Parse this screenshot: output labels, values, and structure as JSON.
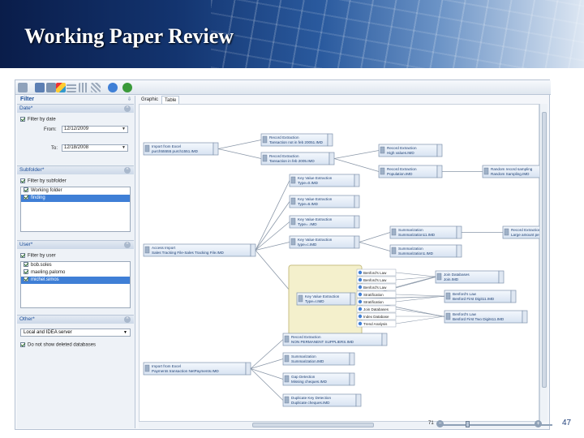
{
  "slide": {
    "title": "Working Paper Review",
    "page_number": "47"
  },
  "filter": {
    "title": "Filter",
    "pin": "⇩",
    "date_section": {
      "title": "Date*",
      "collapse": "^",
      "checkbox_label": "Filter by date",
      "from_label": "From:",
      "from_value": "12/12/2009",
      "to_label": "To:",
      "to_value": "12/18/2008"
    },
    "subfolder_section": {
      "title": "Subfolder*",
      "collapse": "^",
      "checkbox_label": "Filter by subfolder",
      "items": [
        {
          "label": "Working folder",
          "checked": true,
          "selected": false
        },
        {
          "label": "finding",
          "checked": true,
          "selected": true
        }
      ]
    },
    "user_section": {
      "title": "User*",
      "collapse": "^",
      "checkbox_label": "Filter by user",
      "items": [
        {
          "label": "bob.soles",
          "checked": true,
          "selected": false
        },
        {
          "label": "maeling.palomo",
          "checked": true,
          "selected": false
        },
        {
          "label": "michel.simos",
          "checked": true,
          "selected": true
        }
      ]
    },
    "other_section": {
      "title": "Other*",
      "collapse": "^",
      "server_value": "Local and IDEA server",
      "checkbox_label": "Do not show deleted databases"
    }
  },
  "tabs": [
    {
      "label": "Graphic",
      "active": false
    },
    {
      "label": "Table",
      "active": true
    }
  ],
  "zoom": {
    "value": "71",
    "minus": "−",
    "plus": "+"
  },
  "graph": {
    "nodes": [
      {
        "id": "n1",
        "line1": "Import from Excel",
        "line2": "purch55555 purch1551.IMD"
      },
      {
        "id": "n2",
        "line1": "Record Extraction",
        "line2": "Tansaction not in feb 20051.IMD"
      },
      {
        "id": "n3",
        "line1": "Record Extraction",
        "line2": "Tansaction in feb 2005.IMD"
      },
      {
        "id": "n4",
        "line1": "Record Extraction",
        "line2": "High values.IMD"
      },
      {
        "id": "n5",
        "line1": "Record Extraction",
        "line2": "Population.IMD"
      },
      {
        "id": "n6",
        "line1": "Random record sampling",
        "line2": "Random Sampling.IMD"
      },
      {
        "id": "n7",
        "line1": "Key Value Extraction",
        "line2": "Type=0.IMD"
      },
      {
        "id": "n8",
        "line1": "Key Value Extraction",
        "line2": "Type=6.IMD"
      },
      {
        "id": "n9",
        "line1": "Key Value Extraction",
        "line2": "Type= .IMD"
      },
      {
        "id": "n10",
        "line1": "Key Value Extraction",
        "line2": "type=c.IMD"
      },
      {
        "id": "n11",
        "line1": "Access Import",
        "line2": "Sales Tracking File-Sales Tracking File.IMD"
      },
      {
        "id": "n12",
        "line1": "Summarization",
        "line2": "Summarization11.IMD"
      },
      {
        "id": "n13",
        "line1": "Summarization",
        "line2": "Summarization1.IMD"
      },
      {
        "id": "n14",
        "line1": "Record Extraction",
        "line2": "Large amount pe"
      },
      {
        "id": "n15",
        "line1": "Key Value Extraction",
        "line2": "Type=r.IMD"
      },
      {
        "id": "n16",
        "line1": "Join Databases",
        "line2": "Join.IMD"
      },
      {
        "id": "n17",
        "line1": "Benford's Law",
        "line2": "Benford First Digit11.IMD"
      },
      {
        "id": "n18",
        "line1": "Benford's Law",
        "line2": "Benford First Two Digits11.IMD"
      },
      {
        "id": "n19",
        "line1": "Record Extraction",
        "line2": "NON PERMANENT SUPPLIERS.IMD"
      },
      {
        "id": "n20",
        "line1": "Import from Excel",
        "line2": "Payments transaction NetPayments.IMD"
      },
      {
        "id": "n21",
        "line1": "Summarization",
        "line2": "Summarization.IMD"
      },
      {
        "id": "n22",
        "line1": "Gap Detection",
        "line2": "Missing cheques.IMD"
      },
      {
        "id": "n23",
        "line1": "Duplicate Key Detection",
        "line2": "Duplicate cheques.IMD"
      }
    ],
    "menu_items": [
      "Benford's Law",
      "Benford's Law",
      "Benford's Law",
      "Stratification",
      "Stratification",
      "Join Databases",
      "Index Database",
      "Trend Analysis"
    ]
  }
}
